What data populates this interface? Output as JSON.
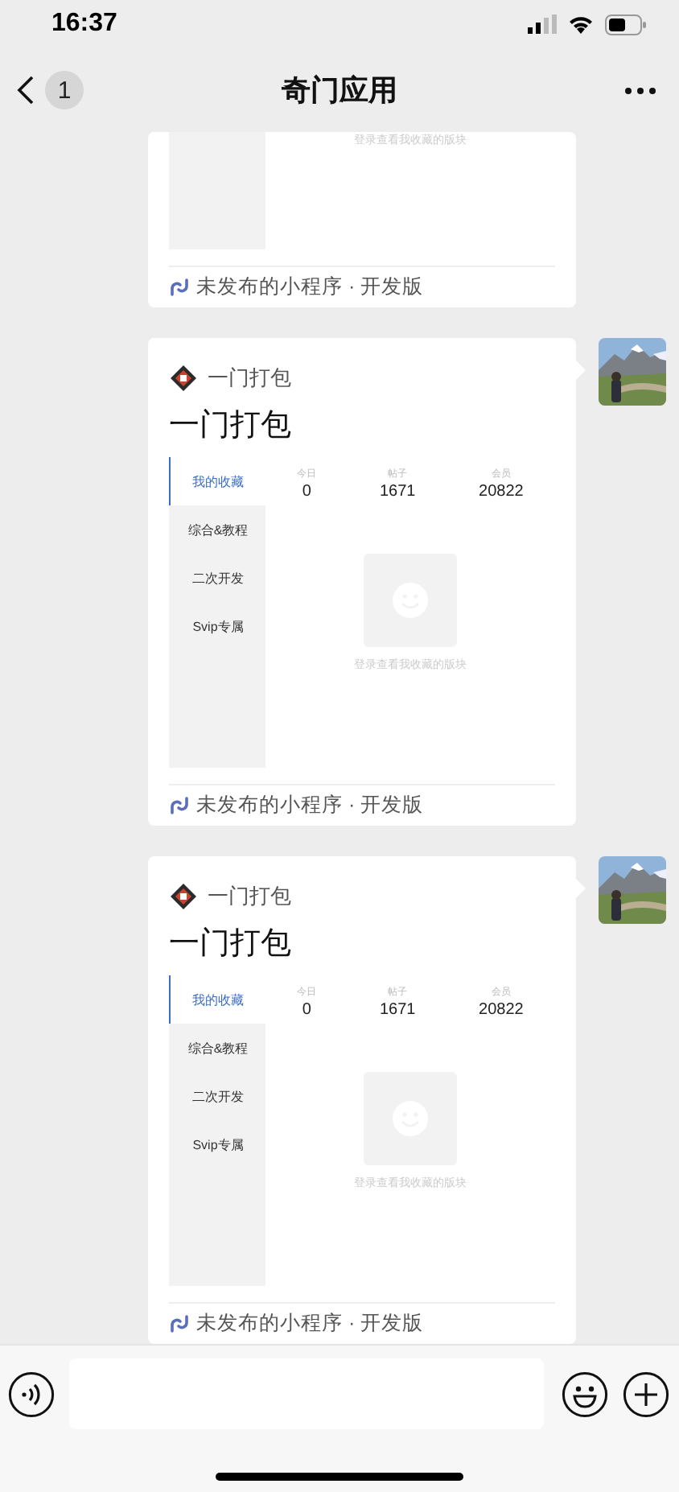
{
  "status_bar": {
    "time": "16:37"
  },
  "nav": {
    "back_count": "1",
    "title": "奇门应用"
  },
  "messages": [
    {
      "kind": "partial",
      "empty_text": "登录查看我收藏的版块",
      "footer": "未发布的小程序 · 开发版"
    },
    {
      "kind": "full",
      "app_name": "一门打包",
      "title": "一门打包",
      "menu": [
        {
          "label": "我的收藏",
          "selected": true
        },
        {
          "label": "综合&教程",
          "selected": false
        },
        {
          "label": "二次开发",
          "selected": false
        },
        {
          "label": "Svip专属",
          "selected": false
        }
      ],
      "stats": [
        {
          "label": "今日",
          "value": "0"
        },
        {
          "label": "帖子",
          "value": "1671"
        },
        {
          "label": "会员",
          "value": "20822"
        }
      ],
      "empty_text": "登录查看我收藏的版块",
      "footer": "未发布的小程序 · 开发版"
    },
    {
      "kind": "full",
      "app_name": "一门打包",
      "title": "一门打包",
      "menu": [
        {
          "label": "我的收藏",
          "selected": true
        },
        {
          "label": "综合&教程",
          "selected": false
        },
        {
          "label": "二次开发",
          "selected": false
        },
        {
          "label": "Svip专属",
          "selected": false
        }
      ],
      "stats": [
        {
          "label": "今日",
          "value": "0"
        },
        {
          "label": "帖子",
          "value": "1671"
        },
        {
          "label": "会员",
          "value": "20822"
        }
      ],
      "empty_text": "登录查看我收藏的版块",
      "footer": "未发布的小程序 · 开发版"
    }
  ]
}
